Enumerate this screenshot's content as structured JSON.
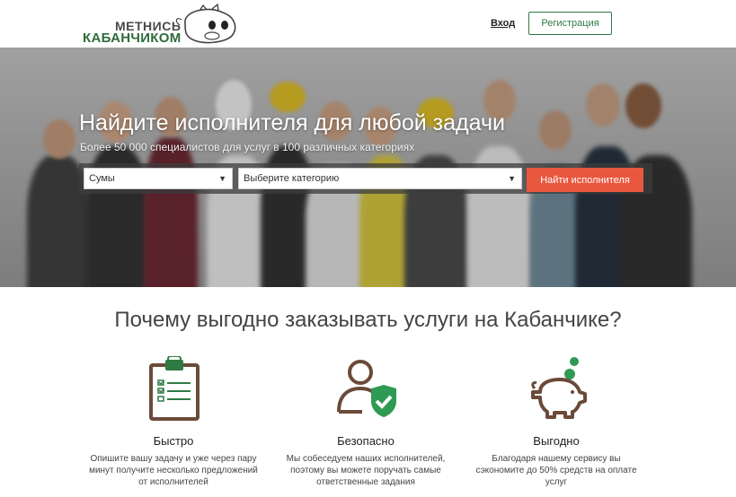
{
  "header": {
    "logo_top": "МЕТНИСЬ",
    "logo_bottom": "КАБАНЧИКОМ",
    "login_label": "Вход",
    "register_label": "Регистрация"
  },
  "hero": {
    "title": "Найдите исполнителя для любой задачи",
    "subtitle": "Более 50 000 специалистов для услуг в 100 различных категориях",
    "city_select": "Сумы",
    "category_select": "Выберите категорию",
    "find_button": "Найти исполнителя"
  },
  "why": {
    "title": "Почему выгодно заказывать услуги на Кабанчике?",
    "features": [
      {
        "icon": "clipboard-icon",
        "title": "Быстро",
        "desc": "Опишите вашу задачу и уже через пару минут получите несколько предложений от исполнителей"
      },
      {
        "icon": "user-shield-icon",
        "title": "Безопасно",
        "desc": "Мы собеседуем наших исполнителей, поэтому вы можете поручать самые ответственные задания"
      },
      {
        "icon": "piggy-bank-icon",
        "title": "Выгодно",
        "desc": "Благодаря нашему сервису вы сэкономите до 50% средств на оплате услуг"
      }
    ]
  },
  "colors": {
    "brand_green": "#2f7a44",
    "icon_brown": "#6b4a3a",
    "accent_orange": "#e9573f"
  }
}
